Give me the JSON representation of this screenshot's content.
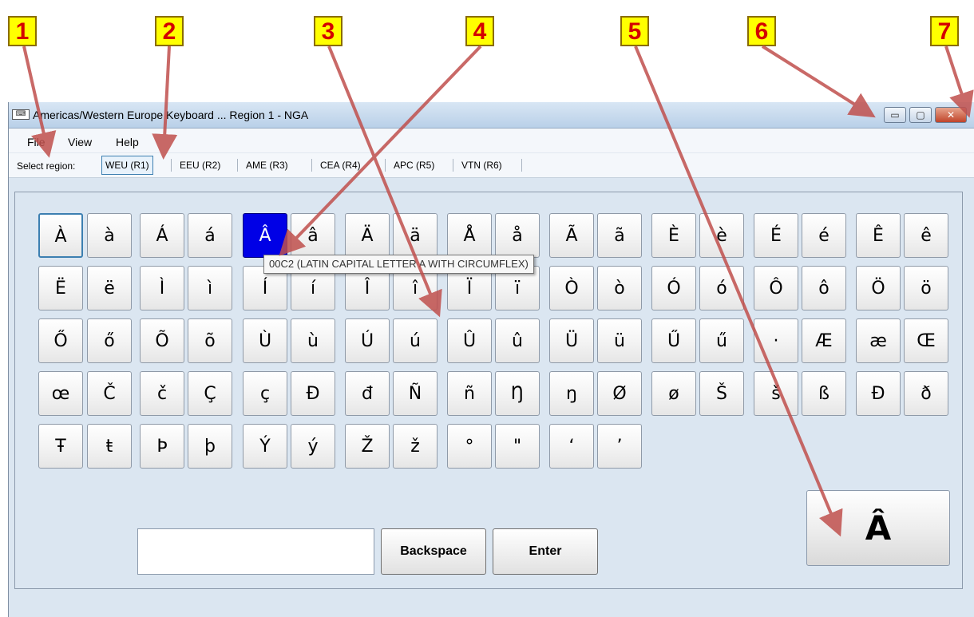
{
  "callouts": [
    "1",
    "2",
    "3",
    "4",
    "5",
    "6",
    "7"
  ],
  "window": {
    "title": "Americas/Western Europe Keyboard ... Region 1 - NGA",
    "icon": "keyboard-icon",
    "controls": {
      "minimize": "▭",
      "maximize": "▢",
      "close": "✕"
    }
  },
  "menu": {
    "file": "File",
    "view": "View",
    "help": "Help"
  },
  "toolbar": {
    "label": "Select region:",
    "regions": [
      "WEU (R1)",
      "EEU (R2)",
      "AME (R3)",
      "CEA (R4)",
      "APC (R5)",
      "VTN (R6)"
    ],
    "active_region": "WEU (R1)"
  },
  "keys": [
    [
      "À",
      "à",
      "Á",
      "á",
      "Â",
      "â",
      "Ä",
      "ä",
      "Å",
      "å",
      "Ã",
      "ã",
      "È",
      "è",
      "É",
      "é",
      "Ê",
      "ê"
    ],
    [
      "Ë",
      "ë",
      "Ì",
      "ì",
      "Í",
      "í",
      "Î",
      "î",
      "Ï",
      "ï",
      "Ò",
      "ò",
      "Ó",
      "ó",
      "Ô",
      "ô",
      "Ö",
      "ö"
    ],
    [
      "Ő",
      "ő",
      "Õ",
      "õ",
      "Ù",
      "ù",
      "Ú",
      "ú",
      "Û",
      "û",
      "Ü",
      "ü",
      "Ű",
      "ű",
      "·",
      "Æ",
      "æ",
      "Œ"
    ],
    [
      "œ",
      "Č",
      "č",
      "Ç",
      "ç",
      "Đ",
      "đ",
      "Ñ",
      "ñ",
      "Ŋ",
      "ŋ",
      "Ø",
      "ø",
      "Š",
      "š",
      "ß",
      "Ð",
      "ð"
    ],
    [
      "Ŧ",
      "ŧ",
      "Þ",
      "þ",
      "Ý",
      "ý",
      "Ž",
      "ž",
      "°",
      "\"",
      "‘",
      "’"
    ]
  ],
  "selected_key": "Â",
  "tooltip": "00C2 (LATIN CAPITAL LETTER A WITH CIRCUMFLEX)",
  "input": {
    "value": ""
  },
  "buttons": {
    "backspace": "Backspace",
    "enter": "Enter"
  },
  "preview_char": "Â",
  "colors": {
    "callout_bg": "#ffff00",
    "callout_text": "#d40000",
    "arrow": "#c0504d",
    "selected_key_bg": "#0000e6",
    "window_bg": "#dbe6f1"
  }
}
